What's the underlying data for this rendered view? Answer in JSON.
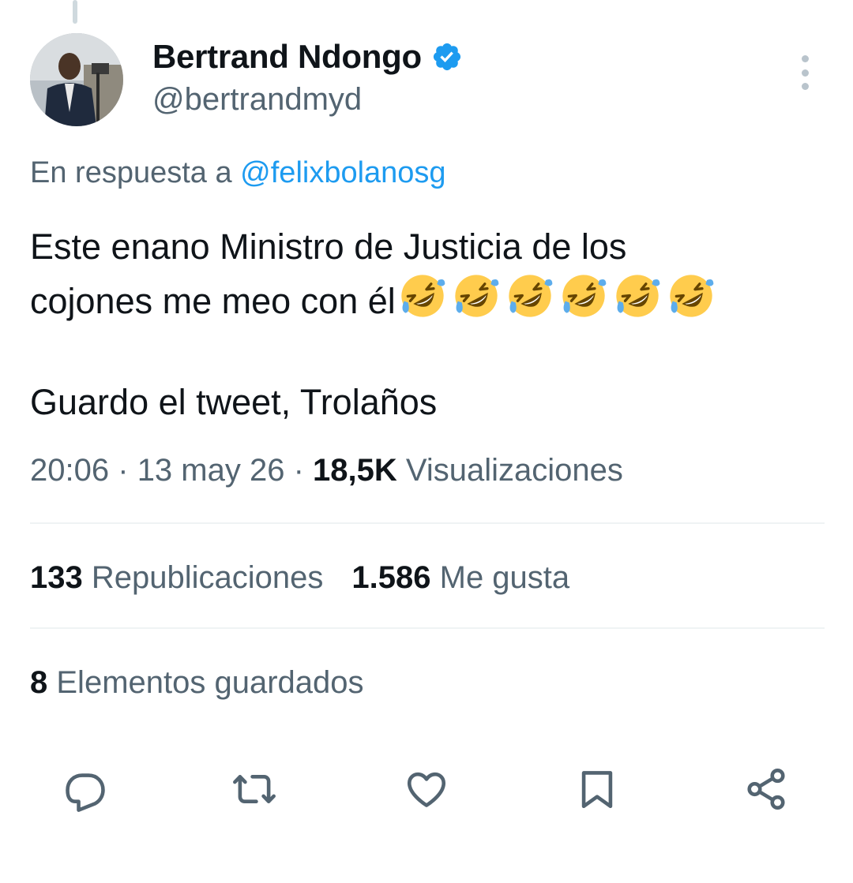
{
  "author": {
    "display_name": "Bertrand Ndongo",
    "handle": "@bertrandmyd",
    "verified": true
  },
  "reply": {
    "prefix": "En respuesta a",
    "mention": "@felixbolanosg"
  },
  "tweet": {
    "line1": "Este enano Ministro de Justicia de los",
    "line2": "cojones me meo con él",
    "emoji": "rolling-on-floor-laughing",
    "emoji_count": 6,
    "line3": "Guardo el tweet, Trolaños"
  },
  "meta": {
    "time": "20:06",
    "separator": "·",
    "date": "13 may 26",
    "views": "18,5K",
    "views_label": "Visualizaciones"
  },
  "stats": {
    "reposts": "133",
    "reposts_label": "Republicaciones",
    "likes": "1.586",
    "likes_label": "Me gusta"
  },
  "bookmarks": {
    "count": "8",
    "label": "Elementos guardados"
  },
  "actions": [
    "reply-icon",
    "repost-icon",
    "like-icon",
    "bookmark-icon",
    "share-icon"
  ],
  "colors": {
    "link": "#1d9bf0",
    "secondary_text": "#536471",
    "icon": "#536471"
  }
}
